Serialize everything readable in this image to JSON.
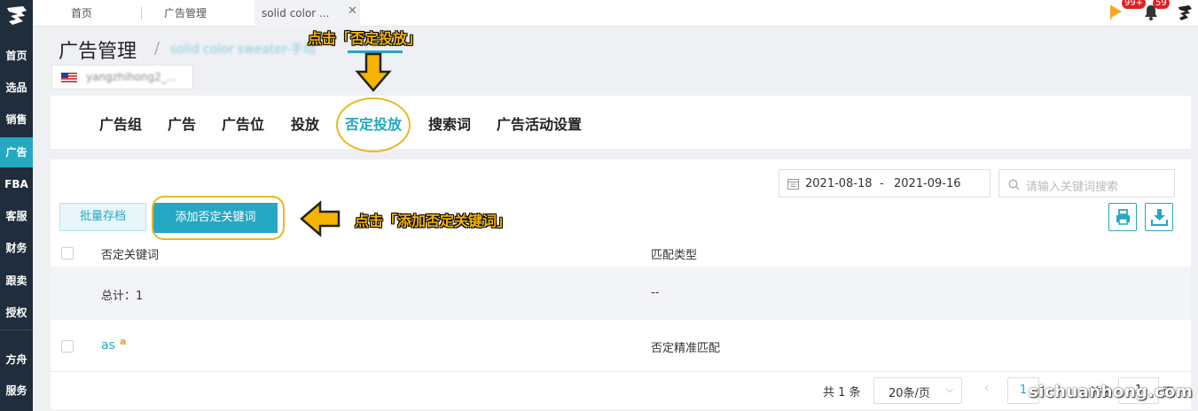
{
  "sidebar": {
    "items": [
      {
        "label": "首页"
      },
      {
        "label": "选品"
      },
      {
        "label": "销售"
      },
      {
        "label": "广告"
      },
      {
        "label": "FBA"
      },
      {
        "label": "客服"
      },
      {
        "label": "财务"
      },
      {
        "label": "跟卖"
      },
      {
        "label": "授权"
      },
      {
        "label": "方舟"
      },
      {
        "label": "服务"
      }
    ]
  },
  "tabs": [
    {
      "label": "首页"
    },
    {
      "label": "广告管理"
    },
    {
      "label": "solid color ..."
    }
  ],
  "header": {
    "notifications": {
      "flag_badge": "99+",
      "bell_badge": "59"
    }
  },
  "page": {
    "title": "广告管理",
    "breadcrumb_sep": "/",
    "breadcrumb": "solid color sweater-手动",
    "account_name": "yangzhihong2_..."
  },
  "nav_tabs": [
    {
      "label": "广告组"
    },
    {
      "label": "广告"
    },
    {
      "label": "广告位"
    },
    {
      "label": "投放"
    },
    {
      "label": "否定投放"
    },
    {
      "label": "搜索词"
    },
    {
      "label": "广告活动设置"
    }
  ],
  "annotations": {
    "top": "点击「否定投放」",
    "right": "点击「添加否定关键词」"
  },
  "toolbar": {
    "date_start": "2021-08-18",
    "date_sep": "-",
    "date_end": "2021-09-16",
    "search_placeholder": "请输入关键词搜索",
    "archive_label": "批量存档",
    "add_label": "添加否定关键词"
  },
  "table": {
    "columns": [
      "否定关键词",
      "匹配类型"
    ],
    "total_label": "总计：1",
    "total_match": "--",
    "rows": [
      {
        "keyword": "as",
        "amazon_mark": "a",
        "match_type": "否定精准匹配"
      }
    ]
  },
  "pagination": {
    "total": "共 1 条",
    "page_size": "20条/页",
    "current_page": "1",
    "goto_label": "前往",
    "goto_value": "1",
    "page_suffix": "页"
  },
  "watermark": "sichuanhong.com",
  "colors": {
    "accent": "#26a7c2",
    "sidebar": "#1f2d3d",
    "highlight": "#f6b400"
  }
}
